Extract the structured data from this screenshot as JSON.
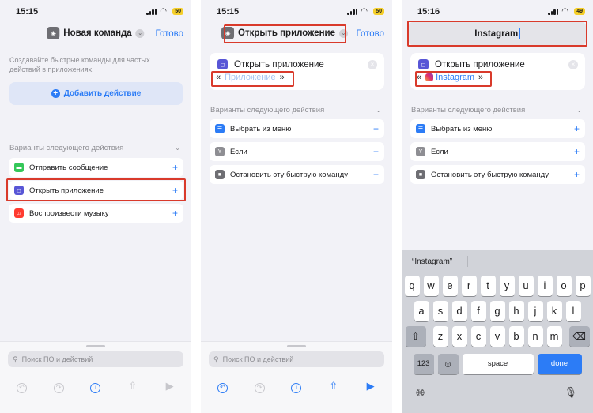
{
  "colors": {
    "accent": "#2c7cf6",
    "highlight": "#d93a2b",
    "battery": "#f5cf2a",
    "background": "#f2f2f7"
  },
  "screen1": {
    "time": "15:15",
    "battery": "50",
    "title": "Новая команда",
    "done": "Готово",
    "hint": "Создавайте быстрые команды для частых действий в приложениях.",
    "add_action": "Добавить действие",
    "section": "Варианты следующего действия",
    "items": [
      {
        "label": "Отправить сообщение",
        "icon": "message-icon"
      },
      {
        "label": "Открыть приложение",
        "icon": "app-icon"
      },
      {
        "label": "Воспроизвести музыку",
        "icon": "music-icon"
      }
    ],
    "search_placeholder": "Поиск ПО и действий"
  },
  "screen2": {
    "time": "15:15",
    "battery": "50",
    "title": "Открыть приложение",
    "done": "Готово",
    "card_title": "Открыть приложение",
    "quote_open": "«",
    "quote_close": "»",
    "param_placeholder": "Приложение",
    "section": "Варианты следующего действия",
    "items": [
      {
        "label": "Выбрать из меню",
        "icon": "menu-icon"
      },
      {
        "label": "Если",
        "icon": "if-icon"
      },
      {
        "label": "Остановить эту быструю команду",
        "icon": "stop-icon"
      }
    ],
    "search_placeholder": "Поиск ПО и действий"
  },
  "screen3": {
    "time": "15:16",
    "battery": "49",
    "name_value": "Instagram",
    "card_title": "Открыть приложение",
    "quote_open": "«",
    "quote_close": "»",
    "param_value": "Instagram",
    "section": "Варианты следующего действия",
    "items": [
      {
        "label": "Выбрать из меню",
        "icon": "menu-icon"
      },
      {
        "label": "Если",
        "icon": "if-icon"
      },
      {
        "label": "Остановить эту быструю команду",
        "icon": "stop-icon"
      }
    ],
    "suggestion": "“Instagram”",
    "keyboard": {
      "row1": [
        "q",
        "w",
        "e",
        "r",
        "t",
        "y",
        "u",
        "i",
        "o",
        "p"
      ],
      "row2": [
        "a",
        "s",
        "d",
        "f",
        "g",
        "h",
        "j",
        "k",
        "l"
      ],
      "row3": [
        "z",
        "x",
        "c",
        "v",
        "b",
        "n",
        "m"
      ],
      "num_key": "123",
      "space_key": "space",
      "done_key": "done"
    }
  }
}
